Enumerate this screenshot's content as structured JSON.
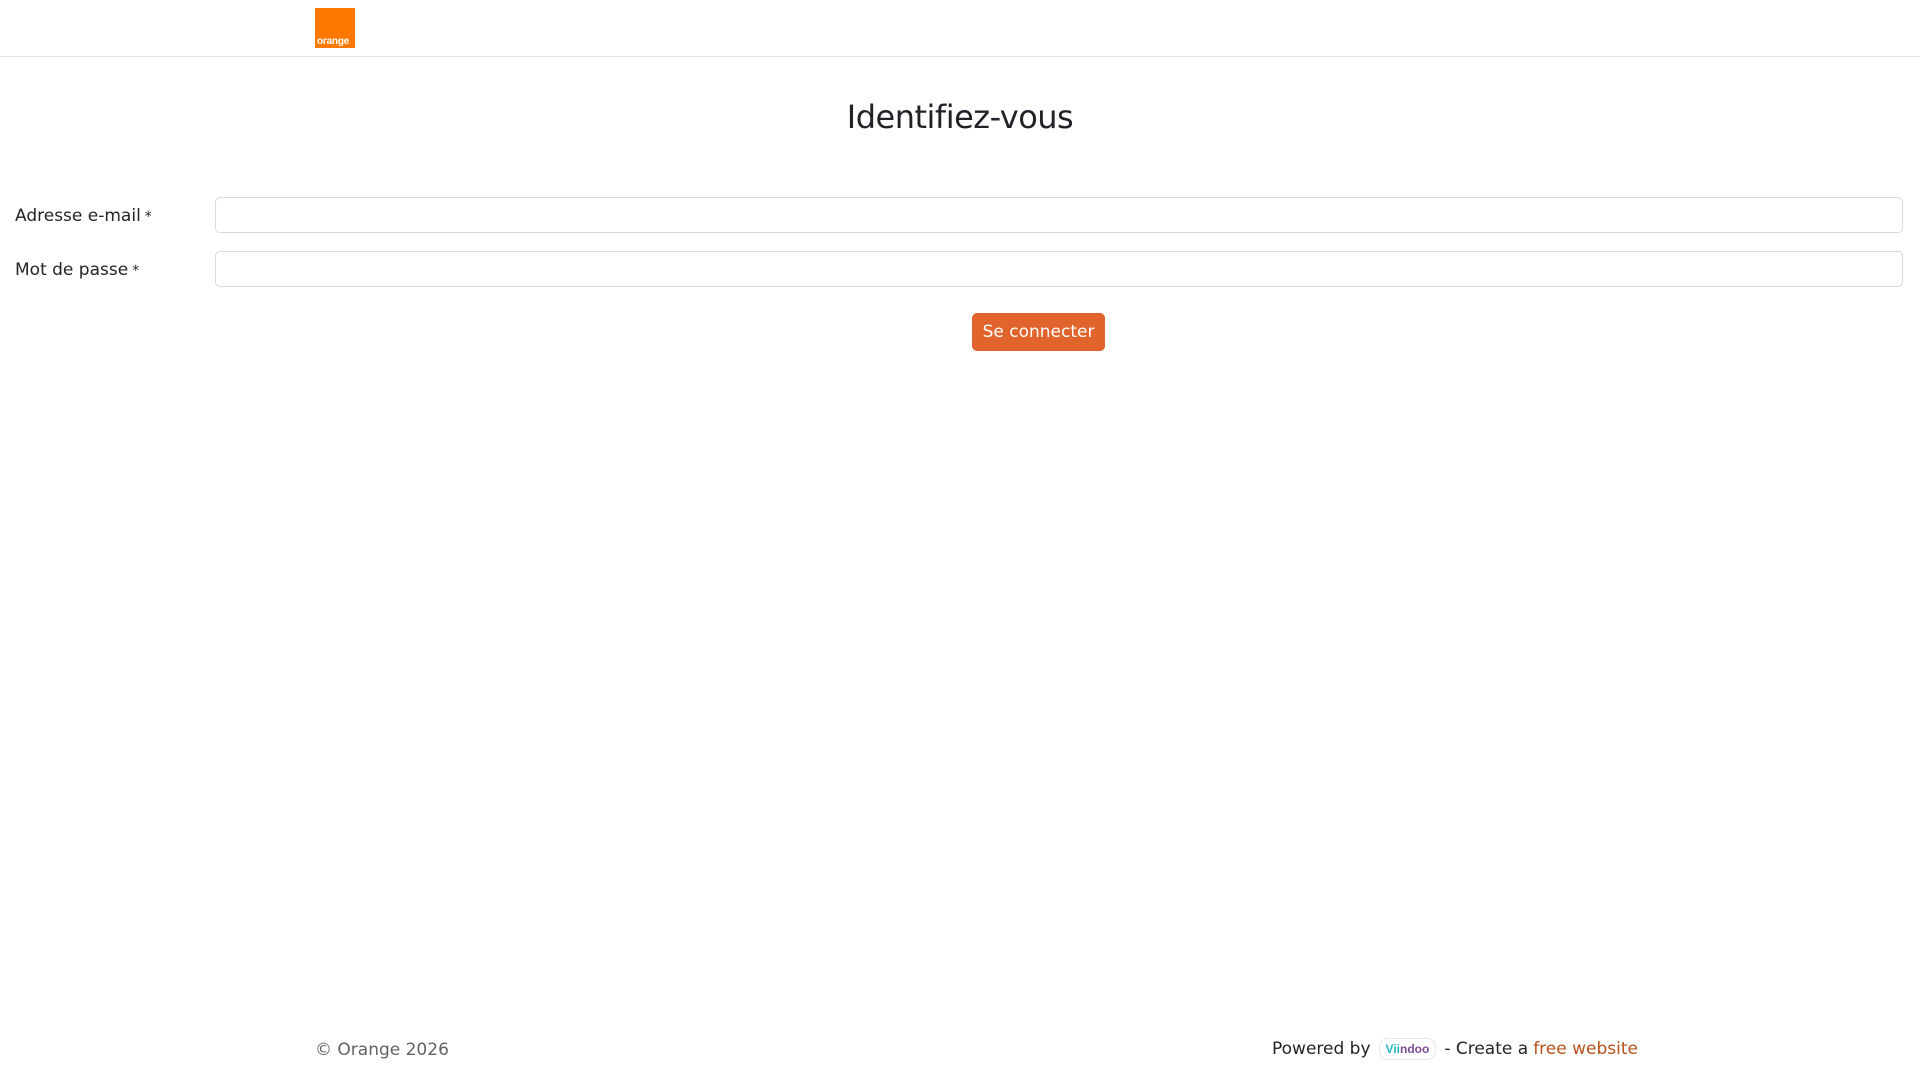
{
  "header": {
    "logo_text": "orange"
  },
  "main": {
    "title": "Identifiez-vous",
    "email": {
      "label": "Adresse e-mail",
      "required_mark": "*",
      "value": "",
      "placeholder": ""
    },
    "password": {
      "label": "Mot de passe",
      "required_mark": "*",
      "value": "",
      "placeholder": ""
    },
    "submit_label": "Se connecter"
  },
  "footer": {
    "copyright": "© Orange 2026",
    "powered_by": "Powered by",
    "viindoo_part1": "Vii",
    "viindoo_part2": "ndoo",
    "create_text": "- Create a",
    "free_website_link": "free website"
  },
  "colors": {
    "brand_orange": "#ff7900",
    "button": "#e0642c",
    "link": "#b5521a"
  },
  "icons": {
    "logo": "orange-logo-icon",
    "powered_badge": "viindoo-logo-icon"
  }
}
